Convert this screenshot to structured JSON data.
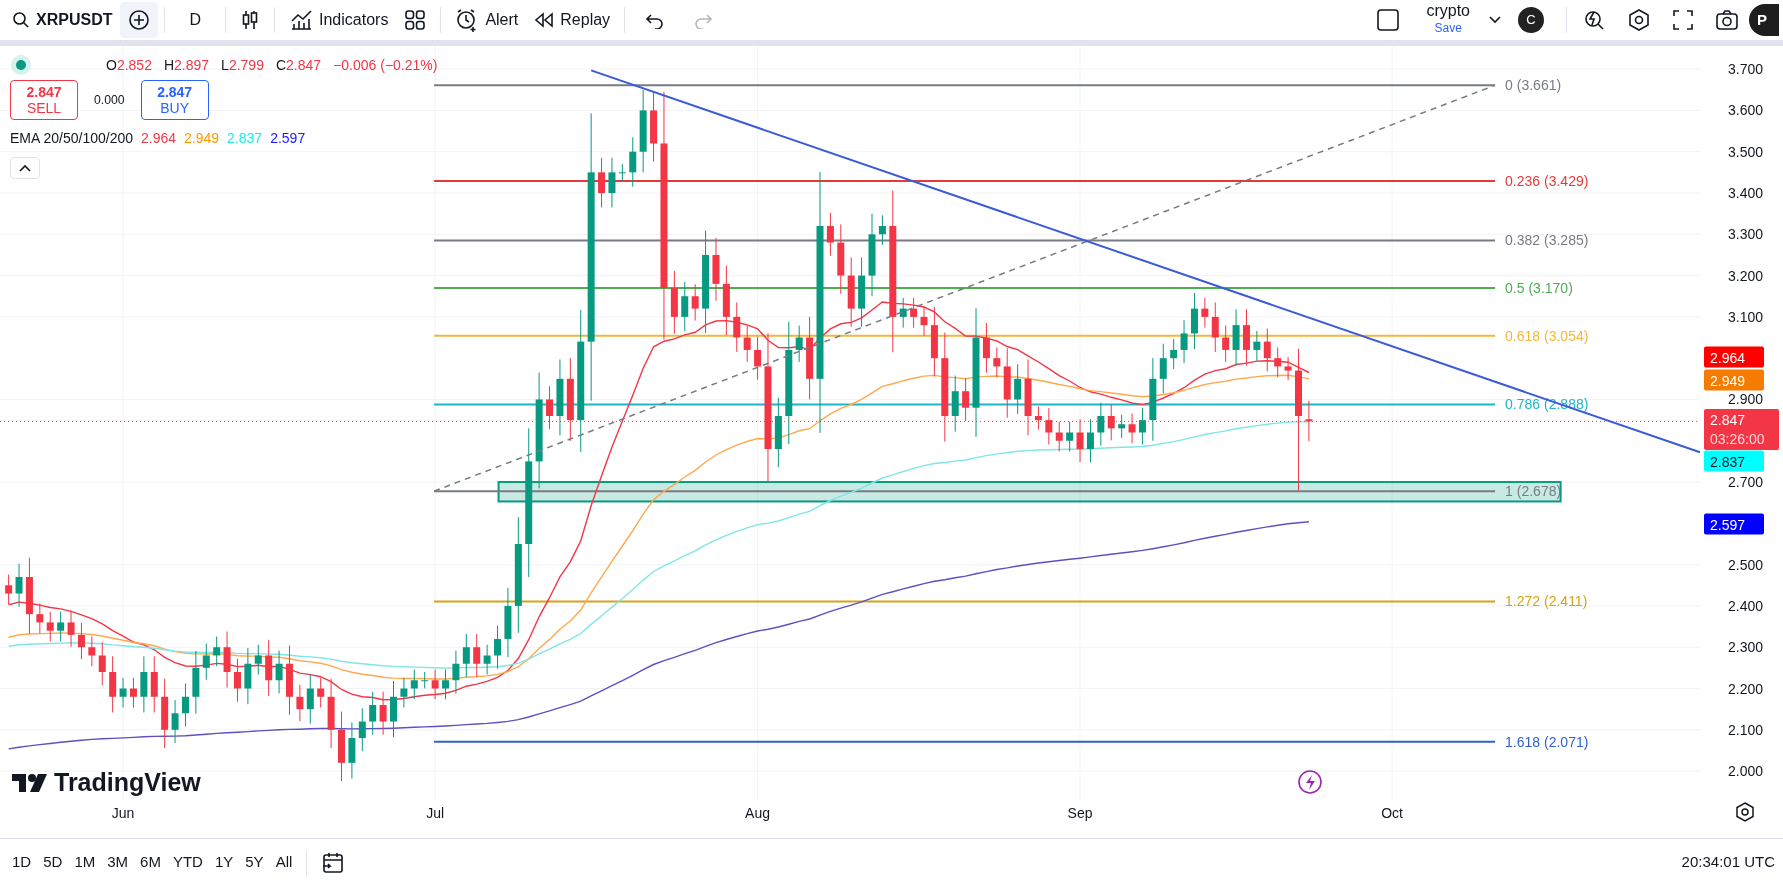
{
  "toolbar": {
    "symbol": "XRPUSDT",
    "interval": "D",
    "indicators_label": "Indicators",
    "alert_label": "Alert",
    "replay_label": "Replay",
    "undo": {
      "disabled": false
    },
    "redo": {
      "disabled": true
    },
    "layout_name": "crypto",
    "save_label": "Save",
    "avatar": "C",
    "profile_cut": "P"
  },
  "legend": {
    "ohlc": [
      {
        "label": "O",
        "value": "2.852"
      },
      {
        "label": "H",
        "value": "2.897"
      },
      {
        "label": "L",
        "value": "2.799"
      },
      {
        "label": "C",
        "value": "2.847"
      }
    ],
    "change": "−0.006 (−0.21%)",
    "sell": {
      "price": "2.847",
      "label": "SELL"
    },
    "spread": "0.000",
    "buy": {
      "price": "2.847",
      "label": "BUY"
    },
    "ema": {
      "label": "EMA 20/50/100/200",
      "values": [
        {
          "value": "2.964",
          "color": "#f23645"
        },
        {
          "value": "2.949",
          "color": "#ff9800"
        },
        {
          "value": "2.837",
          "color": "#1de9e9"
        },
        {
          "value": "2.597",
          "color": "#1a1aff"
        }
      ]
    }
  },
  "fib_levels": [
    {
      "label": "0 (3.661)",
      "color": "#787b86"
    },
    {
      "label": "0.236 (3.429)",
      "color": "#e5383b"
    },
    {
      "label": "0.382 (3.285)",
      "color": "#787b86"
    },
    {
      "label": "0.5 (3.170)",
      "color": "#4caf50"
    },
    {
      "label": "0.618 (3.054)",
      "color": "#f0b73e"
    },
    {
      "label": "0.786 (2.888)",
      "color": "#1fb5c9"
    },
    {
      "label": "1 (2.678)",
      "color": "#787b86"
    },
    {
      "label": "1.272 (2.411)",
      "color": "#d4a418"
    },
    {
      "label": "1.618 (2.071)",
      "color": "#2f5fd0"
    }
  ],
  "price_axis": [
    "3.700",
    "3.600",
    "3.500",
    "3.400",
    "3.300",
    "3.200",
    "3.100",
    "2.900",
    "2.700",
    "2.500",
    "2.400",
    "2.300",
    "2.200",
    "2.100",
    "2.000"
  ],
  "price_badges": [
    {
      "text": "2.964",
      "color": "#ff0000"
    },
    {
      "text": "2.949",
      "color": "#f57c00"
    },
    {
      "text": "2.837",
      "color": "#00ffff"
    },
    {
      "text": "2.597",
      "color": "#0000ff"
    }
  ],
  "current_price": {
    "price": "2.847",
    "countdown": "03:26:00"
  },
  "date_axis": [
    "Jun",
    "Jul",
    "Aug",
    "Sep",
    "Oct"
  ],
  "watermark_logo": "TradingView",
  "timeframes": [
    {
      "label": "1D"
    },
    {
      "label": "5D"
    },
    {
      "label": "1M"
    },
    {
      "label": "3M"
    },
    {
      "label": "6M"
    },
    {
      "label": "YTD"
    },
    {
      "label": "1Y"
    },
    {
      "label": "5Y"
    },
    {
      "label": "All"
    }
  ],
  "clock": "20:34:01 UTC"
}
